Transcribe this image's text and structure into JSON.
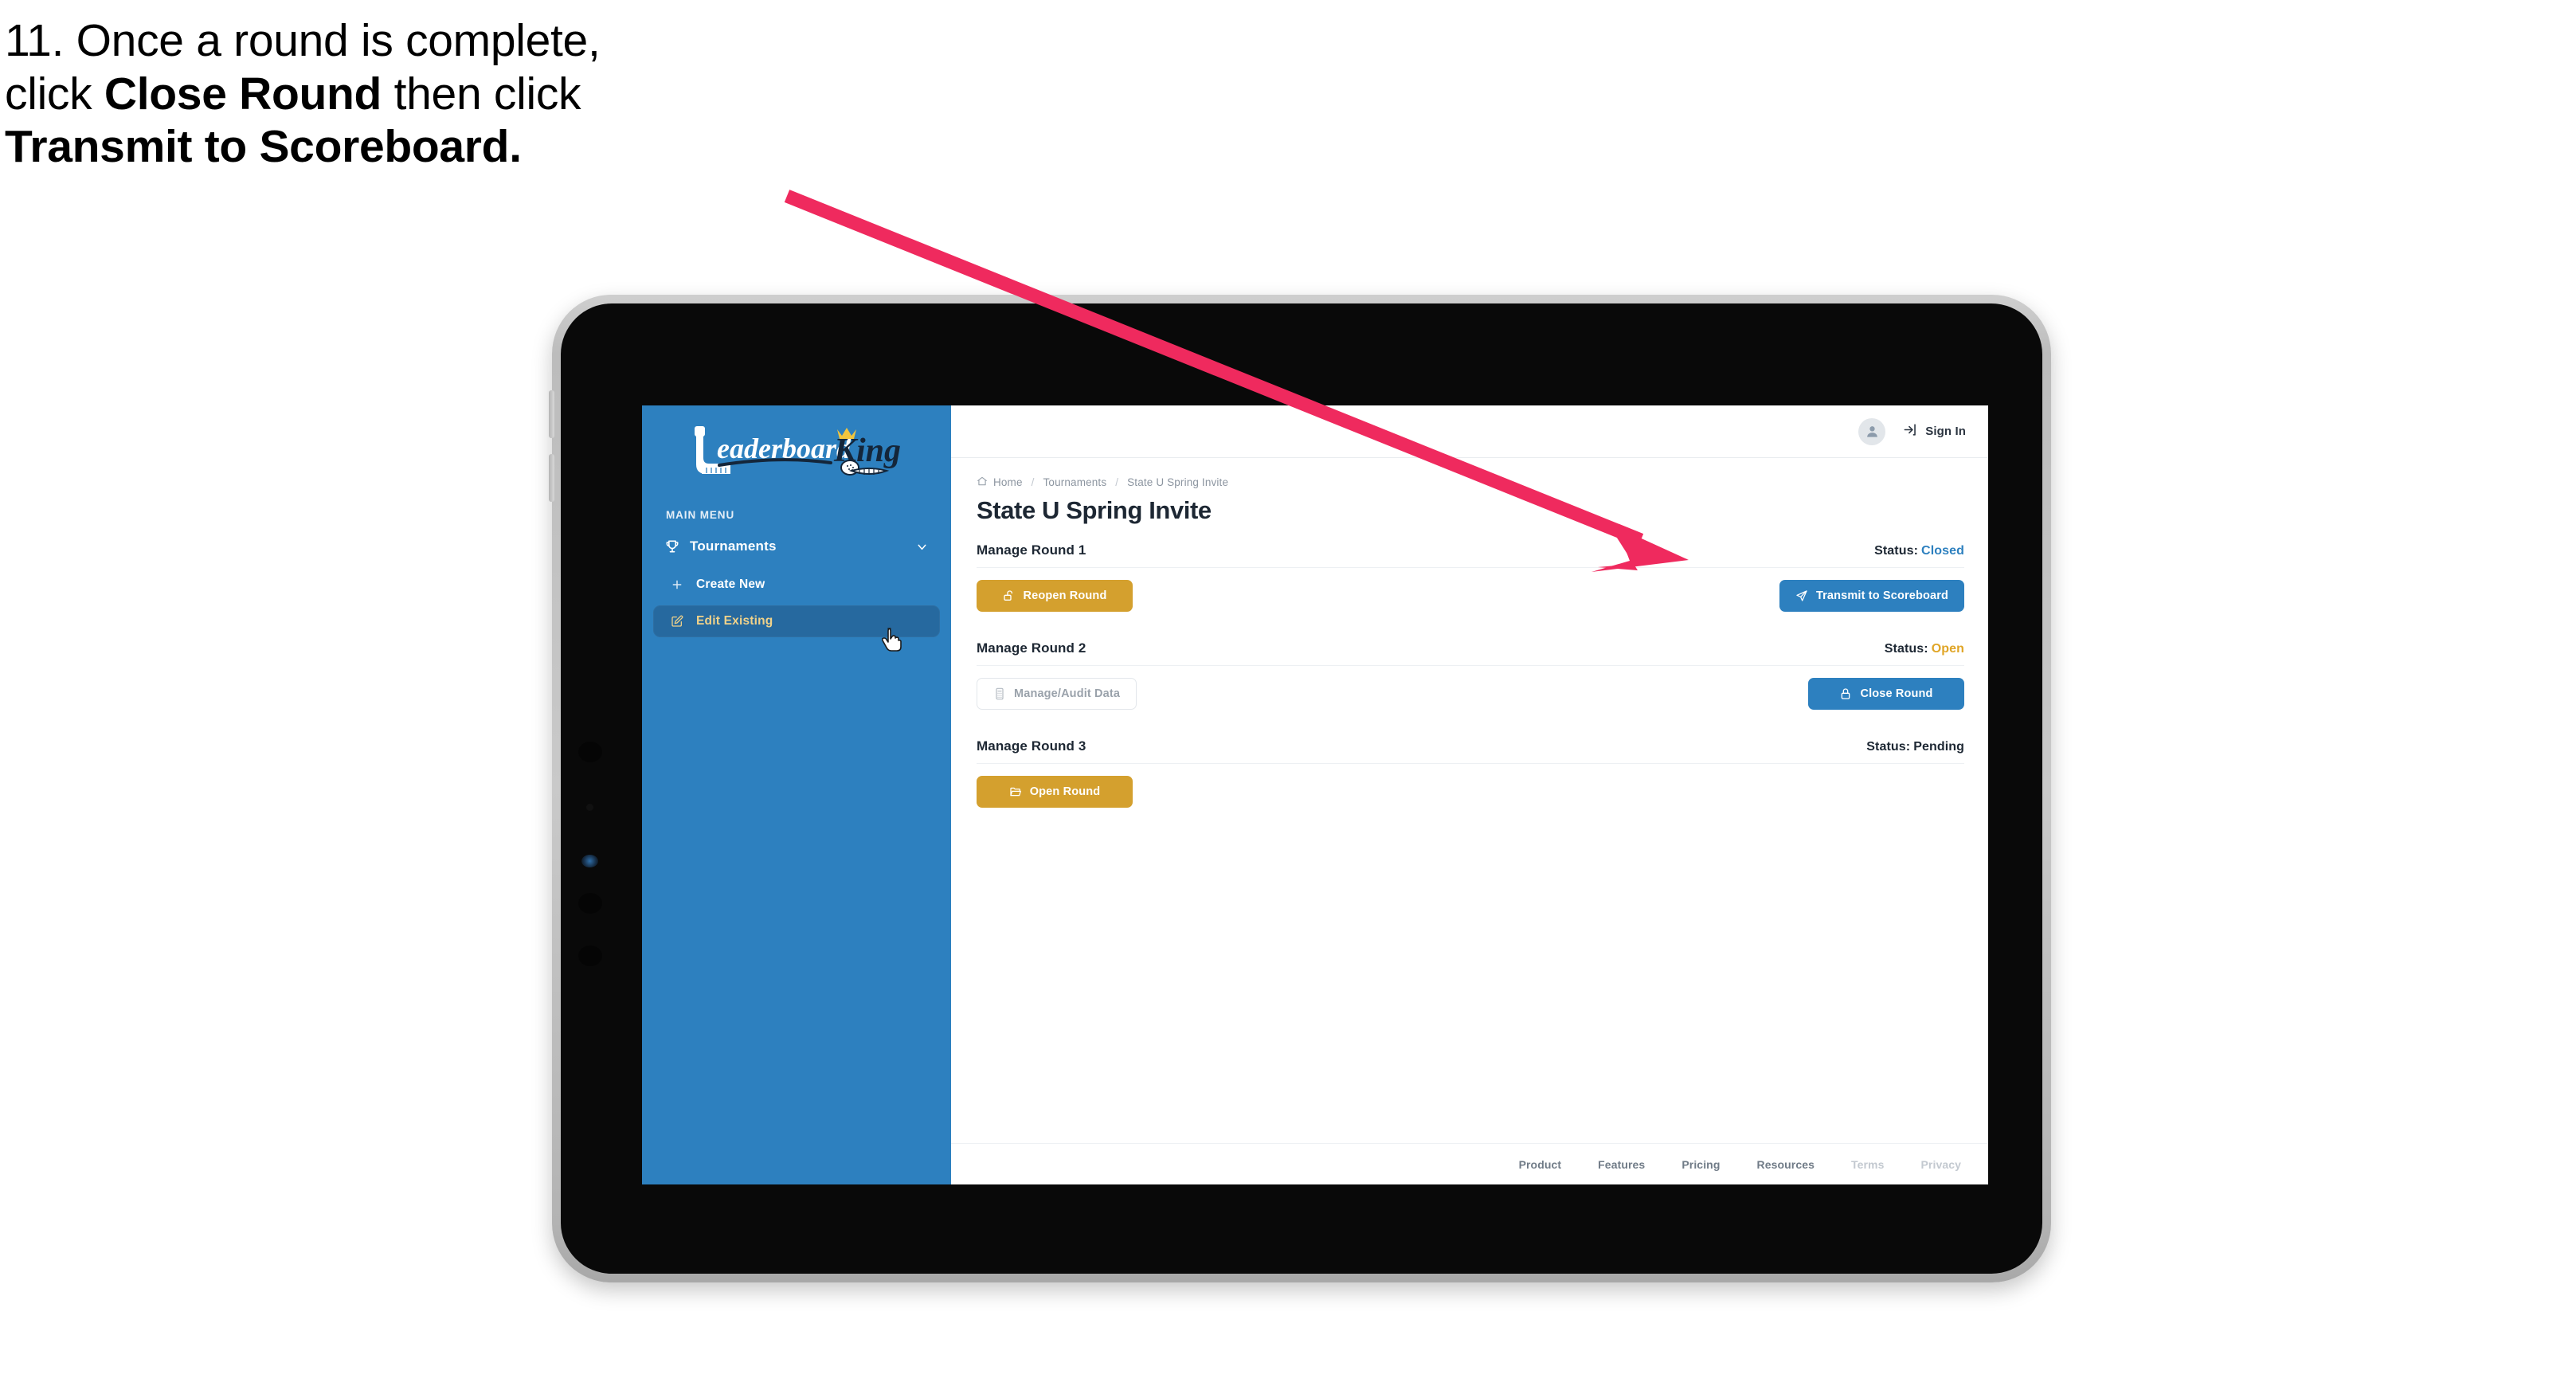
{
  "caption": {
    "line1_plain": "11. Once a round is complete,",
    "line2_pre": "click ",
    "line2_bold": "Close Round",
    "line2_post": " then click",
    "line3_bold": "Transmit to Scoreboard."
  },
  "annotation": {
    "arrow_color": "#ef2a5e"
  },
  "sidebar": {
    "brand": "LeaderboardKing",
    "brand_part1": "Leaderboard",
    "brand_part2": "King",
    "section_label": "MAIN MENU",
    "nav": [
      {
        "label": "Tournaments",
        "icon": "trophy-icon",
        "chevron": "chevron-down-icon",
        "active": false
      }
    ],
    "sub_items": [
      {
        "label": "Create New",
        "icon": "plus-icon",
        "active": false
      },
      {
        "label": "Edit Existing",
        "icon": "edit-icon",
        "active": true
      }
    ],
    "bg_color": "#2d80bf",
    "active_bg_color": "#26699f",
    "active_text_color": "#f0d28a"
  },
  "topbar": {
    "avatar_icon": "user-avatar-icon",
    "signin_icon": "sign-in-arrow-icon",
    "signin_label": "Sign In"
  },
  "breadcrumb": {
    "home_icon": "home-icon",
    "items": [
      "Home",
      "Tournaments",
      "State U Spring Invite"
    ],
    "separator": "/"
  },
  "page": {
    "title": "State U Spring Invite"
  },
  "rounds": [
    {
      "name": "Manage Round 1",
      "status_label": "Status:",
      "status_value": "Closed",
      "status_class": "closed",
      "left_button": {
        "label": "Reopen Round",
        "icon": "unlock-icon",
        "style": "gold"
      },
      "right_button": {
        "label": "Transmit to Scoreboard",
        "icon": "paper-plane-icon",
        "style": "blue"
      }
    },
    {
      "name": "Manage Round 2",
      "status_label": "Status:",
      "status_value": "Open",
      "status_class": "open",
      "left_button": {
        "label": "Manage/Audit Data",
        "icon": "calculator-icon",
        "style": "ghost"
      },
      "right_button": {
        "label": "Close Round",
        "icon": "lock-icon",
        "style": "blue"
      }
    },
    {
      "name": "Manage Round 3",
      "status_label": "Status:",
      "status_value": "Pending",
      "status_class": "pending",
      "left_button": {
        "label": "Open Round",
        "icon": "folder-open-icon",
        "style": "gold"
      },
      "right_button": null
    }
  ],
  "footer": {
    "links": [
      {
        "label": "Product",
        "muted": false
      },
      {
        "label": "Features",
        "muted": false
      },
      {
        "label": "Pricing",
        "muted": false
      },
      {
        "label": "Resources",
        "muted": false
      },
      {
        "label": "Terms",
        "muted": true
      },
      {
        "label": "Privacy",
        "muted": true
      }
    ]
  },
  "colors": {
    "brand_blue": "#2d80bf",
    "gold": "#d4a02e",
    "status_open": "#e0a526",
    "status_closed": "#2d80bf",
    "arrow_pink": "#ef2a5e"
  }
}
